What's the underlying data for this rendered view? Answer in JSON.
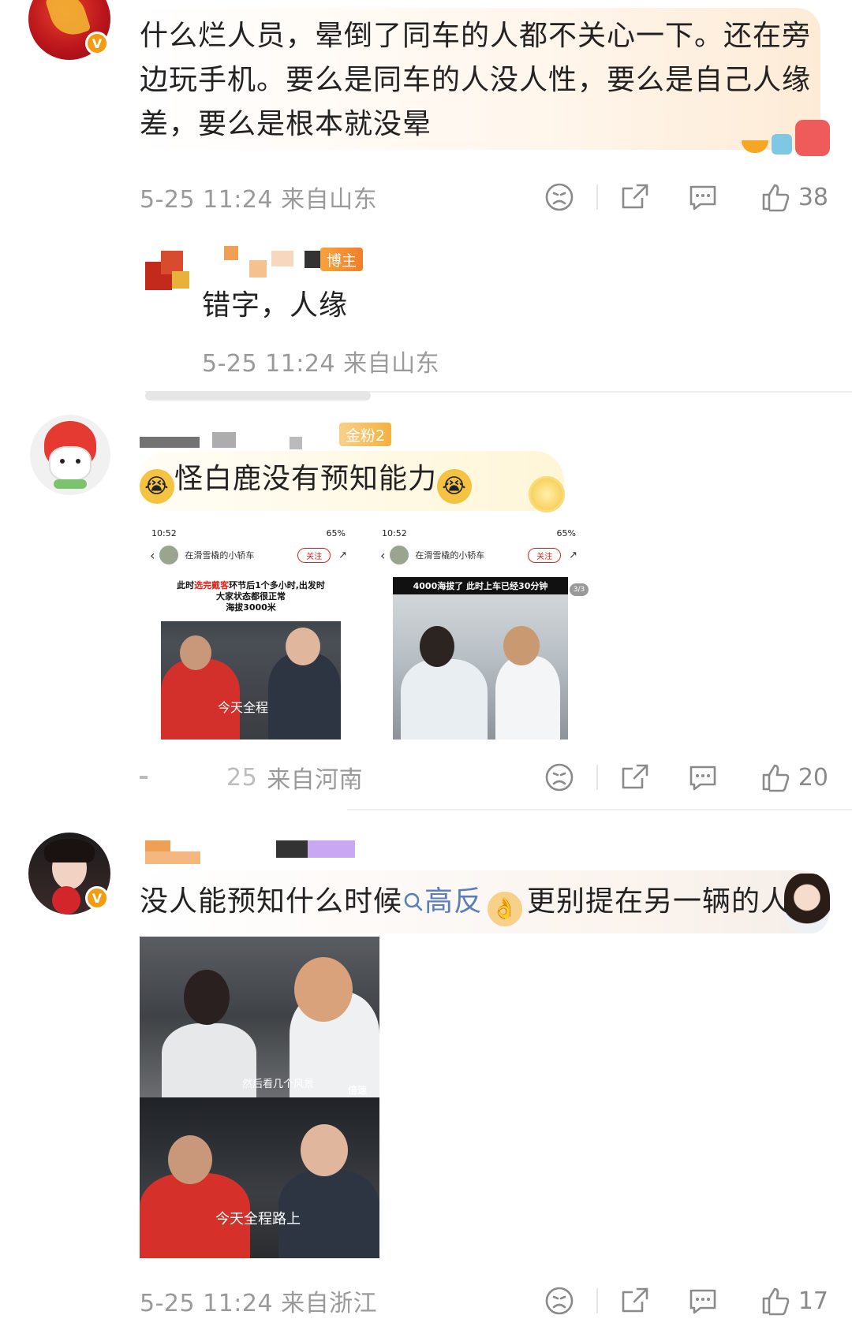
{
  "comments": [
    {
      "text": "什么烂人员，晕倒了同车的人都不关心一下。还在旁边玩手机。要么是同车的人没人性，要么是自己人缘差，要么是根本就没晕",
      "meta": "5-25 11:24 来自山东",
      "likes": "38",
      "reply": {
        "badge": "博主",
        "text": "错字，人缘",
        "meta": "5-25 11:24 来自山东"
      }
    },
    {
      "badge": "金粉2",
      "text": "怪白鹿没有预知能力",
      "meta_visible": "来自河南",
      "meta_partial": "25",
      "likes": "20",
      "screens": [
        {
          "time": "10:52",
          "battery": "65%",
          "account": "在滑雪橇的小轿车",
          "follow": "关注",
          "caption_a": "此时",
          "caption_red": "选完戴客",
          "caption_b": "环节后1个多小时,出发时",
          "caption_2": "大家状态都很正常",
          "caption_3": "海拔3000米",
          "subtitle": "今天",
          "subtitle_2": "全程"
        },
        {
          "time": "10:52",
          "battery": "65%",
          "account": "在滑雪橇的小轿车",
          "follow": "关注",
          "caption_a": "4000海拔了 此时上车已经30分钟",
          "page": "3/3"
        }
      ]
    },
    {
      "text_a": "没人能预知什么时候",
      "link": "高反",
      "text_b": "更别提在另一辆的人",
      "meta": "5-25 11:24 来自浙江",
      "likes": "17",
      "photo": {
        "top_caption": "然后看几个风景",
        "top_label": "倍速",
        "bottom_caption": "今天全程路上"
      }
    }
  ],
  "icons": [
    "sad-face-icon",
    "share-icon",
    "comment-icon",
    "thumbs-up-icon",
    "search-icon"
  ],
  "colors": {
    "meta_gray": "#9a9a9a",
    "badge_orange": "#f39c12",
    "link_blue": "#5b7fb8",
    "red": "#e2231a"
  }
}
